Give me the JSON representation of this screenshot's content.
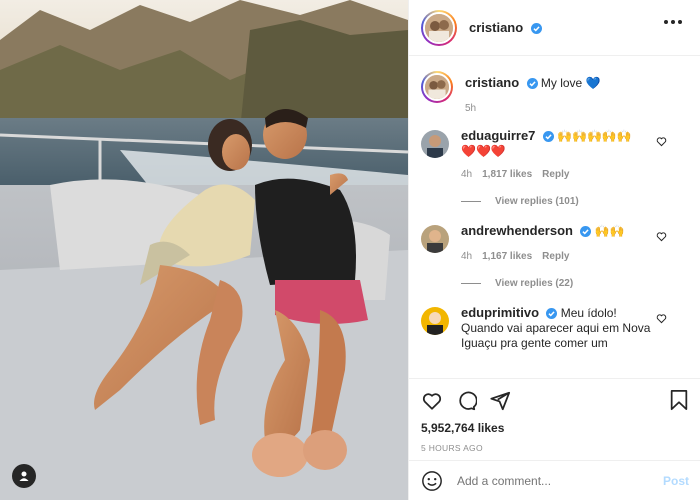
{
  "post": {
    "username": "cristiano",
    "caption": "My love",
    "caption_emoji": "💙",
    "caption_time": "5h",
    "likes": "5,952,764 likes",
    "posted_ago": "5 HOURS AGO"
  },
  "comments": [
    {
      "username": "eduaguirre7",
      "text": "🙌🙌🙌🙌🙌",
      "text2": "❤️❤️❤️",
      "time": "4h",
      "likes": "1,817 likes",
      "reply": "Reply",
      "view_replies": "View replies (101)"
    },
    {
      "username": "andrewhenderson",
      "text": "🙌🙌",
      "time": "4h",
      "likes": "1,167 likes",
      "reply": "Reply",
      "view_replies": "View replies (22)"
    },
    {
      "username": "eduprimitivo",
      "text": "Meu ídolo! Quando vai aparecer aqui em Nova Iguaçu pra gente comer um"
    }
  ],
  "add_comment": {
    "placeholder": "Add a comment...",
    "post_label": "Post"
  },
  "icons": {
    "verified": "verified-badge-icon",
    "more": "more-options-icon",
    "like": "heart-icon",
    "comment": "comment-icon",
    "share": "share-icon",
    "save": "bookmark-icon",
    "emoji": "emoji-icon",
    "tag": "user-tag-icon"
  },
  "colors": {
    "verified_blue": "#3897f0",
    "post_button": "#b3dbff",
    "muted_text": "#8e8e8e"
  }
}
